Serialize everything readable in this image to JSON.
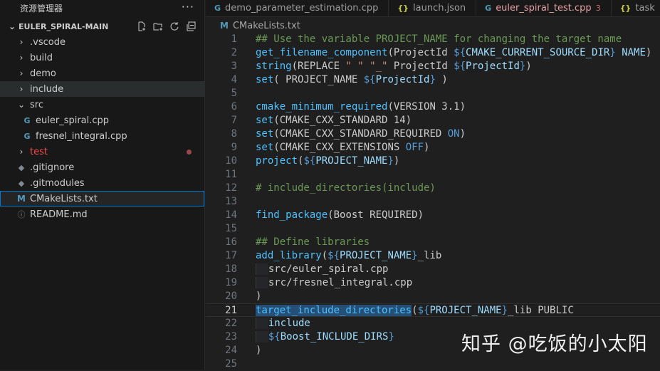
{
  "sidebar": {
    "title": "资源管理器",
    "more": "···",
    "project": "EULER_SPIRAL-MAIN",
    "items": [
      {
        "label": ".vscode",
        "type": "folder"
      },
      {
        "label": "build",
        "type": "folder"
      },
      {
        "label": "demo",
        "type": "folder"
      },
      {
        "label": "include",
        "type": "folder"
      },
      {
        "label": "src",
        "type": "folder-open"
      },
      {
        "label": "euler_spiral.cpp",
        "type": "cpp"
      },
      {
        "label": "fresnel_integral.cpp",
        "type": "cpp"
      },
      {
        "label": "test",
        "type": "folder"
      },
      {
        "label": ".gitignore",
        "type": "git"
      },
      {
        "label": ".gitmodules",
        "type": "git"
      },
      {
        "label": "CMakeLists.txt",
        "type": "cmake"
      },
      {
        "label": "README.md",
        "type": "info"
      }
    ]
  },
  "tabs": [
    {
      "label": "demo_parameter_estimation.cpp",
      "icon": "cpp-icon"
    },
    {
      "label": "launch.json",
      "icon": "json-icon"
    },
    {
      "label": "euler_spiral_test.cpp",
      "icon": "cpp-icon",
      "badge": "3"
    },
    {
      "label": "task",
      "icon": "json-icon"
    }
  ],
  "breadcrumb": "CMakeLists.txt",
  "current_line": 21,
  "line_numbers": [
    "1",
    "2",
    "3",
    "4",
    "5",
    "6",
    "7",
    "8",
    "9",
    "10",
    "11",
    "12",
    "13",
    "14",
    "15",
    "16",
    "17",
    "18",
    "19",
    "20",
    "21",
    "22",
    "23",
    "24",
    "25"
  ],
  "watermark": "知乎 @吃饭的小太阳",
  "colors": {
    "accent": "#0078d4",
    "comment": "#6a9955",
    "function": "#4fc1ff",
    "variable": "#9cdcfe",
    "string": "#ce9178",
    "keyword": "#569cd6",
    "error": "#f14c4c"
  }
}
